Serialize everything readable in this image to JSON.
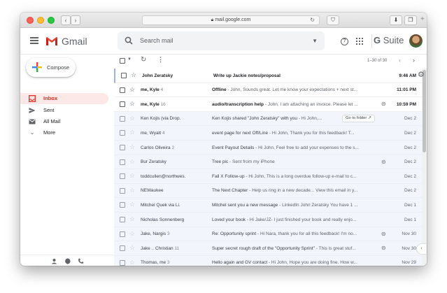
{
  "browser": {
    "url": "mail.google.com",
    "lock_icon": "lock-icon",
    "back": "‹",
    "forward": "›",
    "tab_plus": "+"
  },
  "header": {
    "app_name": "Gmail",
    "search_placeholder": "Search mail",
    "gsuite_prefix": "G",
    "gsuite_suffix": " Suite"
  },
  "sidebar": {
    "compose_label": "Compose",
    "items": [
      {
        "label": "Inbox",
        "icon": "inbox-icon",
        "active": true
      },
      {
        "label": "Sent",
        "icon": "send-icon",
        "active": false
      },
      {
        "label": "All Mail",
        "icon": "all-mail-icon",
        "active": false
      },
      {
        "label": "More",
        "icon": "chevron-down-icon",
        "active": false
      }
    ]
  },
  "toolbar": {
    "count_text": "1–30 of 30"
  },
  "emails": [
    {
      "sender": "John Zeratsky",
      "count": "",
      "subject": "Write up Jackie notes/proposal",
      "snippet": "",
      "date": "9:46 AM",
      "unread": true,
      "attachment": false,
      "chip": ""
    },
    {
      "sender": "me, Kyle",
      "count": "4",
      "subject": "Offline",
      "snippet": " - John, Sounds great. Let me know your expectations + next st...",
      "date": "11:01 PM",
      "unread": true,
      "attachment": false,
      "chip": ""
    },
    {
      "sender": "me, Kyle",
      "count": "16",
      "subject": "audio/transcription help",
      "snippet": " - John, I am attaching an invoice. Please let ...",
      "date": "10:59 PM",
      "unread": true,
      "attachment": true,
      "chip": ""
    },
    {
      "sender": "Ken Kojis (via Drop.",
      "count": "",
      "subject": "Ken Kojis shared \"John Zeratsky\" with you",
      "snippet": " - Hi John,...",
      "date": "Dec 2",
      "unread": false,
      "attachment": false,
      "chip": "Go to folder ↗"
    },
    {
      "sender": "me, Wyatt",
      "count": "4",
      "subject": "event page for next Off/Line",
      "snippet": " - Hi John, Thank you for this feedback! T...",
      "date": "Dec 2",
      "unread": false,
      "attachment": false,
      "chip": ""
    },
    {
      "sender": "Carlos Oliveira",
      "count": "2",
      "subject": "Event Payout Details",
      "snippet": " - Hi John, Feel free to add your expenses to the s...",
      "date": "Dec 2",
      "unread": false,
      "attachment": false,
      "chip": ""
    },
    {
      "sender": "Bur Zeratsky",
      "count": "",
      "subject": "Tree pic",
      "snippet": " - Sent from my iPhone",
      "date": "Dec 2",
      "unread": false,
      "attachment": true,
      "chip": ""
    },
    {
      "sender": "toddcullen@northwes.",
      "count": "",
      "subject": "Fall X Follow-up",
      "snippet": " - Hi John, This is a long overdue follow-up e-mail to c...",
      "date": "Dec 2",
      "unread": false,
      "attachment": false,
      "chip": ""
    },
    {
      "sender": "NEWaukee",
      "count": "",
      "subject": "The Next Chapter",
      "snippet": " - Help us ring in a new decade... View this email in y...",
      "date": "Dec 2",
      "unread": false,
      "attachment": false,
      "chip": ""
    },
    {
      "sender": "Mitchel Quek via Li.",
      "count": "",
      "subject": "Mitchel sent you a new message",
      "snippet": " - LinkedIn John Zeratsky You have 1 ...",
      "date": "Dec 1",
      "unread": false,
      "attachment": false,
      "chip": ""
    },
    {
      "sender": "Nicholas Sonnenberg",
      "count": "",
      "subject": "Loved your book",
      "snippet": " - Hi Jake/JZ- I just finished your book and really enjo...",
      "date": "Dec 1",
      "unread": false,
      "attachment": false,
      "chip": ""
    },
    {
      "sender": "Jake, Nargis",
      "count": "3",
      "subject": "Re: Opportunity sprint",
      "snippet": " - Hi Nara, thank you for all this feedback! I'm no...",
      "date": "Nov 30",
      "unread": false,
      "attachment": true,
      "chip": ""
    },
    {
      "sender": "Jake .. Christian",
      "count": "11",
      "subject": "Super secret rough draft of the \"Opportunity Sprint\"",
      "snippet": " - This is great stuf...",
      "date": "Nov 30",
      "unread": false,
      "attachment": true,
      "chip": ""
    },
    {
      "sender": "Thomas, me",
      "count": "3",
      "subject": "Hello again and GV contact",
      "snippet": " - Hi John, Hope you are doing fine. How w...",
      "date": "Nov 29",
      "unread": false,
      "attachment": false,
      "chip": ""
    }
  ]
}
